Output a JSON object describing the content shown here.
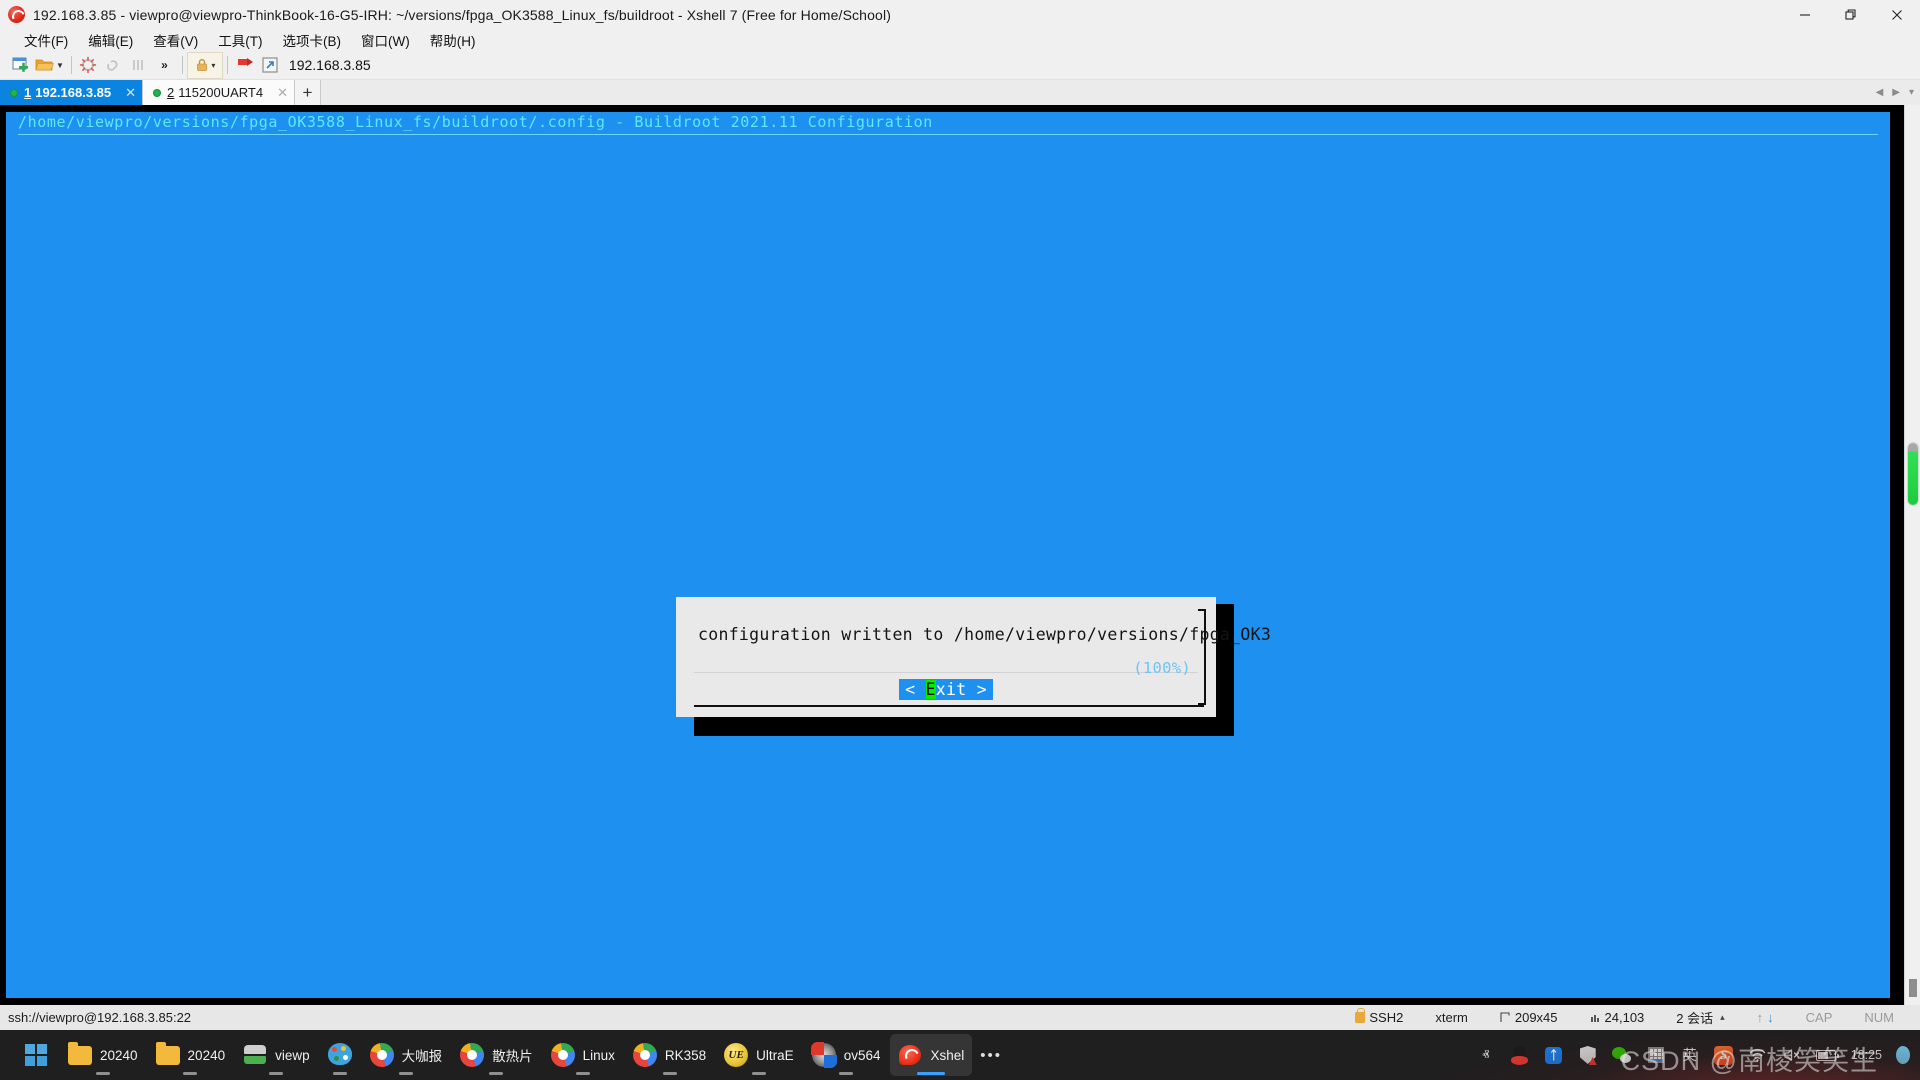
{
  "window": {
    "title": "192.168.3.85 - viewpro@viewpro-ThinkBook-16-G5-IRH: ~/versions/fpga_OK3588_Linux_fs/buildroot - Xshell 7 (Free for Home/School)",
    "app_icon": "xshell-logo",
    "minimize_label": "—",
    "restore_label": "❐",
    "close_label": "✕"
  },
  "menubar": {
    "items": [
      {
        "label": "文件(F)",
        "name": "menu-file"
      },
      {
        "label": "编辑(E)",
        "name": "menu-edit"
      },
      {
        "label": "查看(V)",
        "name": "menu-view"
      },
      {
        "label": "工具(T)",
        "name": "menu-tools"
      },
      {
        "label": "选项卡(B)",
        "name": "menu-tabs"
      },
      {
        "label": "窗口(W)",
        "name": "menu-window"
      },
      {
        "label": "帮助(H)",
        "name": "menu-help"
      }
    ]
  },
  "toolbar": {
    "address_value": "192.168.3.85",
    "overflow_label": "»"
  },
  "tabs": {
    "items": [
      {
        "num": "1",
        "label": "192.168.3.85",
        "active": true,
        "status": "connected"
      },
      {
        "num": "2",
        "label": "115200UART4",
        "active": false,
        "status": "connected"
      }
    ],
    "add_label": "+",
    "close_label": "✕",
    "nav_prev": "◀",
    "nav_next": "▶",
    "nav_menu": "▾"
  },
  "terminal": {
    "header_line": "/home/viewpro/versions/fpga_OK3588_Linux_fs/buildroot/.config - Buildroot 2021.11 Configuration",
    "background_color": "#1e90f0",
    "header_color": "#5fe8ff",
    "dialog": {
      "message": "configuration written to /home/viewpro/versions/fpga_OK3",
      "percent_label": "(100%)",
      "button_prefix": "< ",
      "button_hotkey": "E",
      "button_rest": "xit",
      "button_suffix": " >",
      "button_full": "< Exit >",
      "button_bg": "#1e90f0",
      "hotkey_bg": "#00ee00"
    }
  },
  "statusbar": {
    "connection": "ssh://viewpro@192.168.3.85:22",
    "protocol": "SSH2",
    "terminal_type": "xterm",
    "size": "209x45",
    "cursor": "24,103",
    "sessions": "2 会话",
    "cap": "CAP",
    "num": "NUM",
    "size_icon": "resize-icon",
    "cursor_icon": "cursor-position-icon",
    "expand_icon": "▴",
    "upload_icon": "↑",
    "download_icon": "↓"
  },
  "taskbar": {
    "start_label": "start-button",
    "items": [
      {
        "label": "20240",
        "icon": "folder-icon",
        "active": false
      },
      {
        "label": "20240",
        "icon": "folder-icon",
        "active": false
      },
      {
        "label": "viewp",
        "icon": "server-icon",
        "active": false
      },
      {
        "label": "",
        "icon": "paint-icon",
        "active": false
      },
      {
        "label": "大咖报",
        "icon": "chrome-icon",
        "active": false
      },
      {
        "label": "散热片",
        "icon": "chrome-icon",
        "active": false
      },
      {
        "label": "Linux",
        "icon": "chrome-icon",
        "active": false
      },
      {
        "label": "RK358",
        "icon": "chrome-icon",
        "active": false
      },
      {
        "label": "UltraE",
        "icon": "ultraedit-icon",
        "active": false
      },
      {
        "label": "ov564",
        "icon": "recovery-icon",
        "active": false
      },
      {
        "label": "Xshel",
        "icon": "xshell-icon",
        "active": true
      }
    ],
    "overflow_label": "•••",
    "tray": {
      "expand_label": "ⱏ",
      "icons": [
        "qq-icon",
        "bluetooth-icon",
        "security-shield-icon",
        "wechat-icon",
        "grid-app-icon"
      ],
      "ime_label": "英",
      "sogou_label": "S",
      "wifi_label": "wifi-icon",
      "volume_label": "volume-muted-icon",
      "battery_label": "battery-charging-icon"
    },
    "clock": {
      "time": "18:25"
    },
    "watermark": "CSDN @南棱笑笑生"
  }
}
